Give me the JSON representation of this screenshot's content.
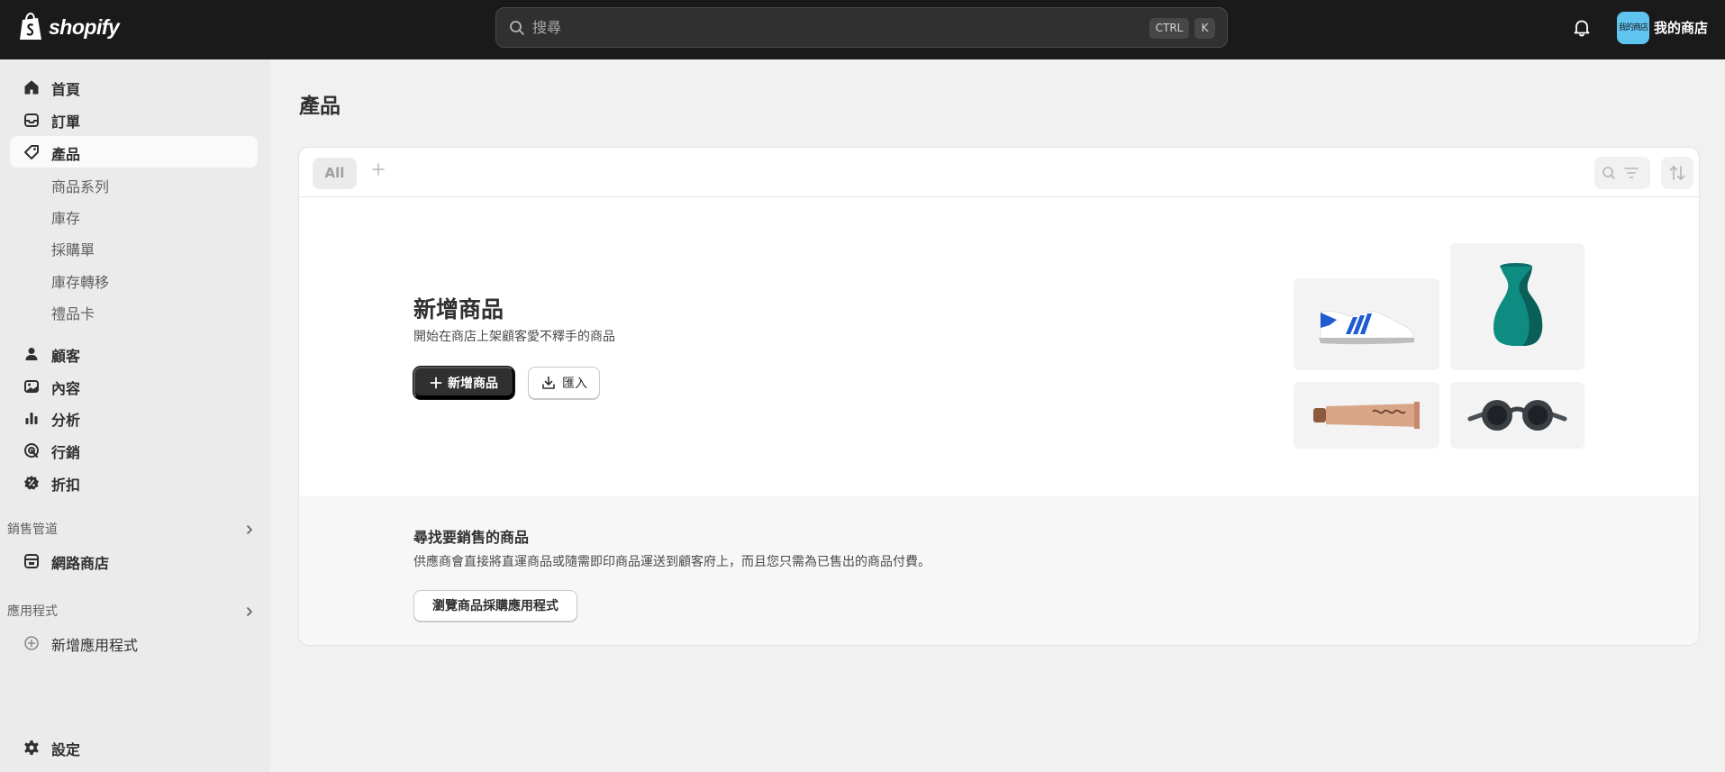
{
  "topbar": {
    "logo_text": "shopify",
    "search_placeholder": "搜尋",
    "shortcut_keys": [
      "CTRL",
      "K"
    ],
    "avatar_text": "我的商店",
    "avatar_color": "#5fc4f0",
    "store_name": "我的商店"
  },
  "sidebar": {
    "items": [
      {
        "label": "首頁",
        "icon": "home-icon"
      },
      {
        "label": "訂單",
        "icon": "inbox-icon"
      },
      {
        "label": "產品",
        "icon": "tag-icon",
        "active": true
      },
      {
        "label": "顧客",
        "icon": "person-icon"
      },
      {
        "label": "內容",
        "icon": "image-icon"
      },
      {
        "label": "分析",
        "icon": "bar-chart-icon"
      },
      {
        "label": "行銷",
        "icon": "target-icon"
      },
      {
        "label": "折扣",
        "icon": "discount-icon"
      }
    ],
    "product_subitems": [
      "商品系列",
      "庫存",
      "採購單",
      "庫存轉移",
      "禮品卡"
    ],
    "sales_channels": {
      "heading": "銷售管道",
      "items": [
        {
          "label": "網路商店",
          "icon": "store-icon"
        }
      ]
    },
    "apps": {
      "heading": "應用程式",
      "add_label": "新增應用程式"
    },
    "settings_label": "設定"
  },
  "main": {
    "page_title": "產品",
    "tabs": [
      {
        "label": "All"
      }
    ],
    "empty_state": {
      "title": "新增商品",
      "subtitle": "開始在商店上架顧客愛不釋手的商品",
      "primary_button": "新增商品",
      "secondary_button": "匯入"
    },
    "footer": {
      "title": "尋找要銷售的商品",
      "subtitle": "供應商會直接將直運商品或隨需即印商品運送到顧客府上，而且您只需為已售出的商品付費。",
      "button": "瀏覽商品採購應用程式"
    }
  }
}
